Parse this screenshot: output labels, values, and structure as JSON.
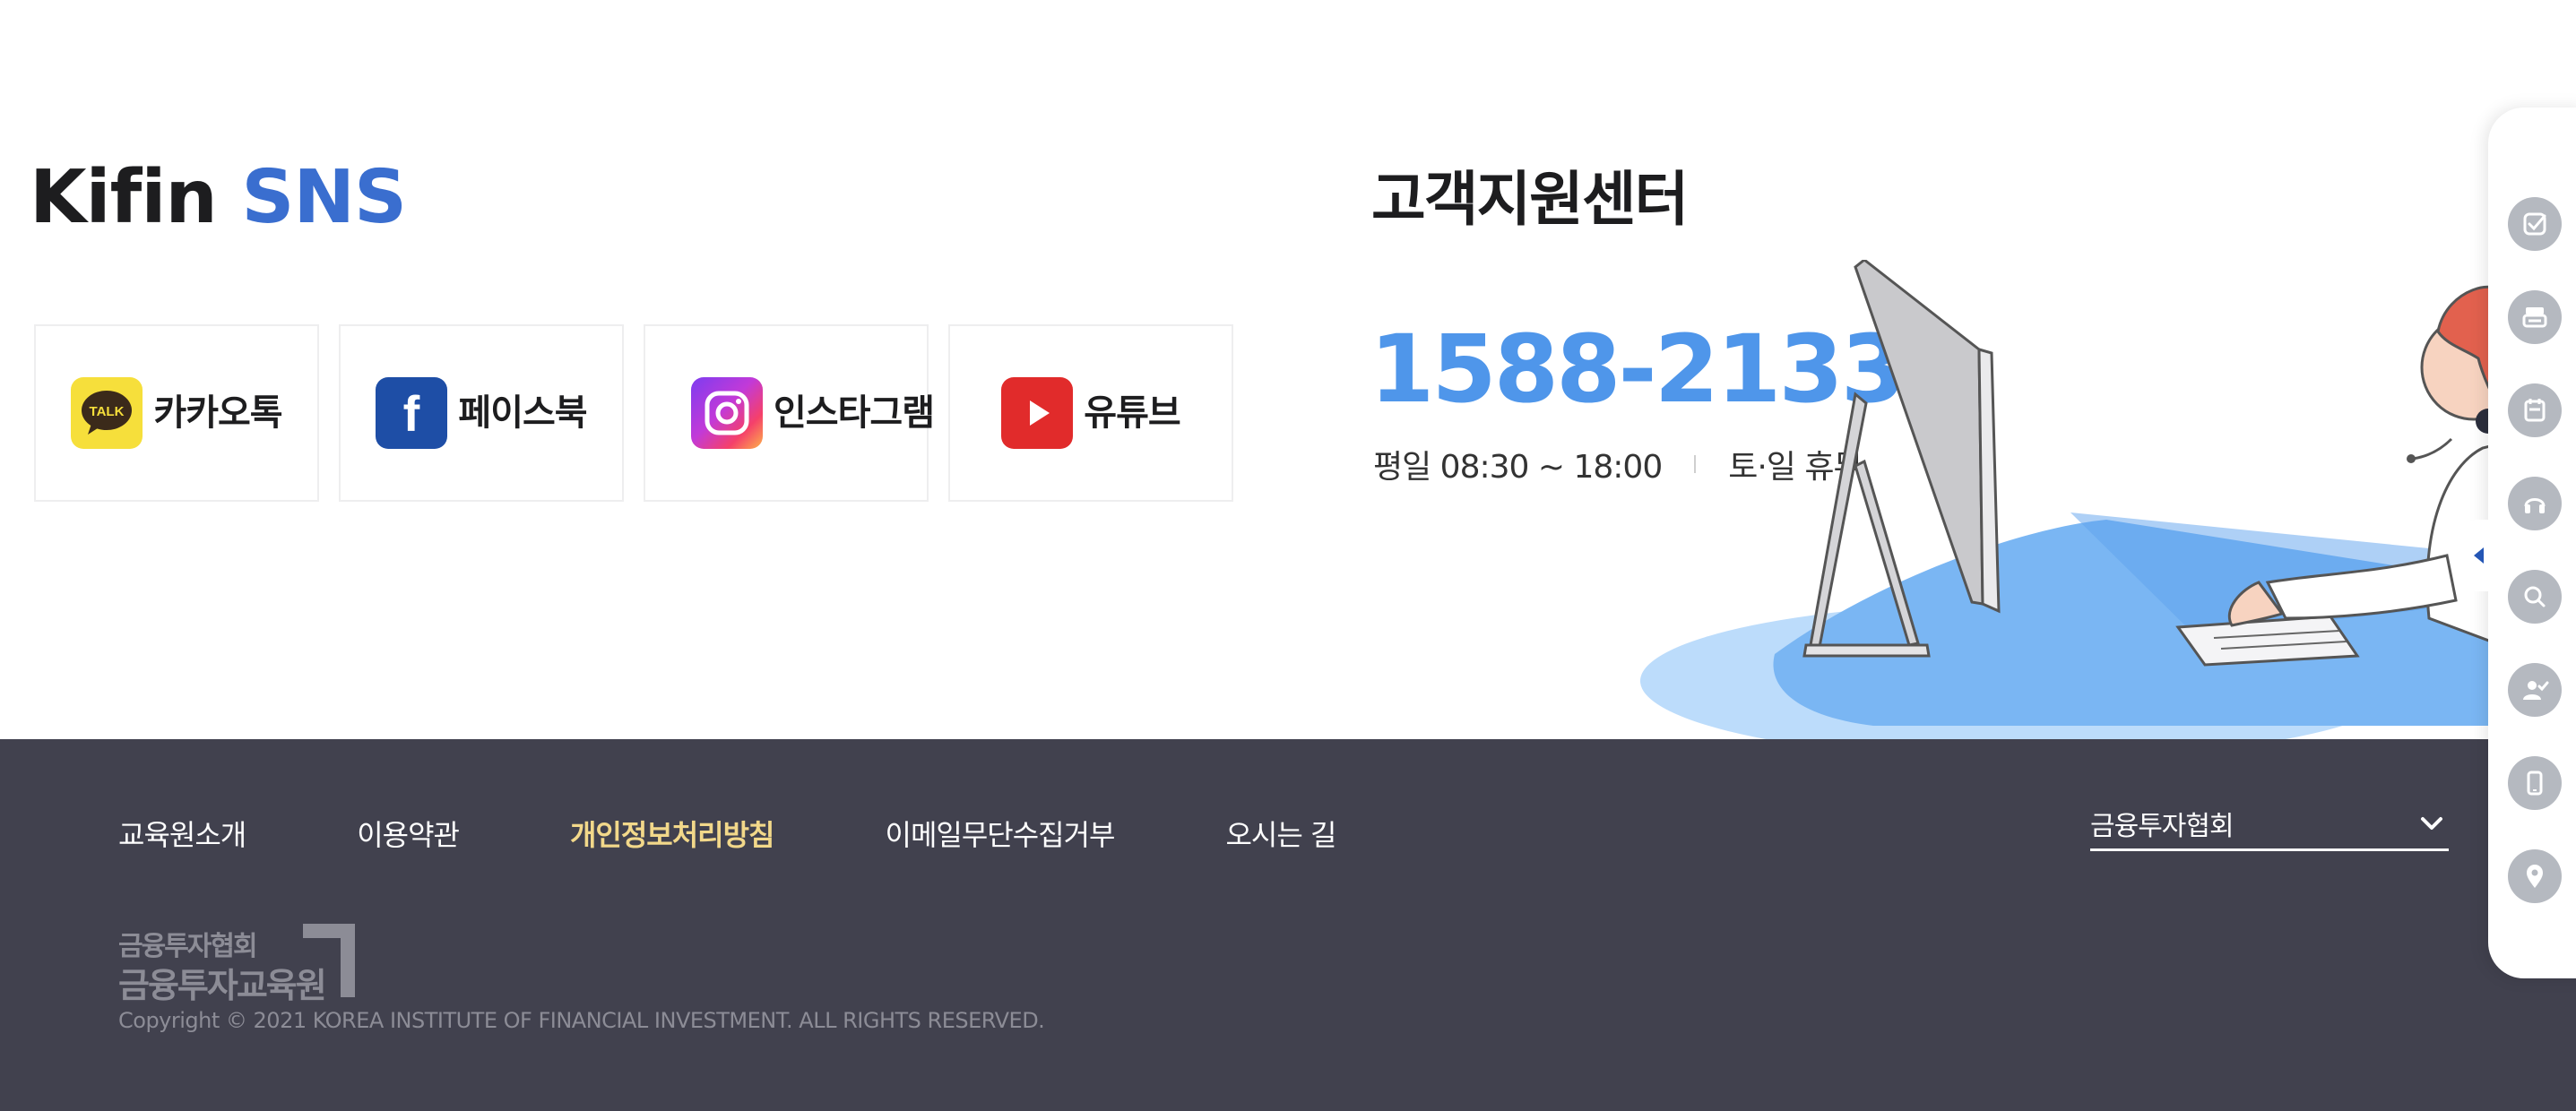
{
  "sns": {
    "title_prefix": "Kifin",
    "title_accent": "SNS",
    "items": [
      {
        "label": "카카오톡",
        "icon": "kakaotalk-icon",
        "icon_text": "TALK"
      },
      {
        "label": "페이스북",
        "icon": "facebook-icon",
        "icon_text": "f"
      },
      {
        "label": "인스타그램",
        "icon": "instagram-icon"
      },
      {
        "label": "유튜브",
        "icon": "youtube-icon"
      }
    ]
  },
  "customer_center": {
    "title": "고객지원센터",
    "phone": "1588-2133",
    "weekday_hours": "평일 08:30 ~ 18:00",
    "weekend": "토·일 휴무"
  },
  "footer": {
    "nav": [
      {
        "label": "교육원소개"
      },
      {
        "label": "이용약관"
      },
      {
        "label": "개인정보처리방침",
        "highlight": true
      },
      {
        "label": "이메일무단수집거부"
      },
      {
        "label": "오시는 길"
      }
    ],
    "family_site": {
      "selected": "금융투자협회"
    },
    "logo": {
      "line1": "금융투자협회",
      "line2": "금융투자교육원"
    },
    "copyright": "Copyright © 2021 KOREA INSTITUTE OF FINANCIAL INVESTMENT. ALL RIGHTS RESERVED."
  },
  "quick_menu": {
    "icons": [
      "check-icon",
      "printer-icon",
      "calendar-icon",
      "headset-icon",
      "search-icon",
      "user-check-icon",
      "mobile-icon",
      "location-pin-icon"
    ]
  },
  "colors": {
    "accent": "#3a6ecf",
    "phone": "#4f96ea",
    "footer_bg": "#41414e",
    "nav_highlight": "#f2d88a",
    "quick_icon_bg": "#b5b9c0"
  }
}
